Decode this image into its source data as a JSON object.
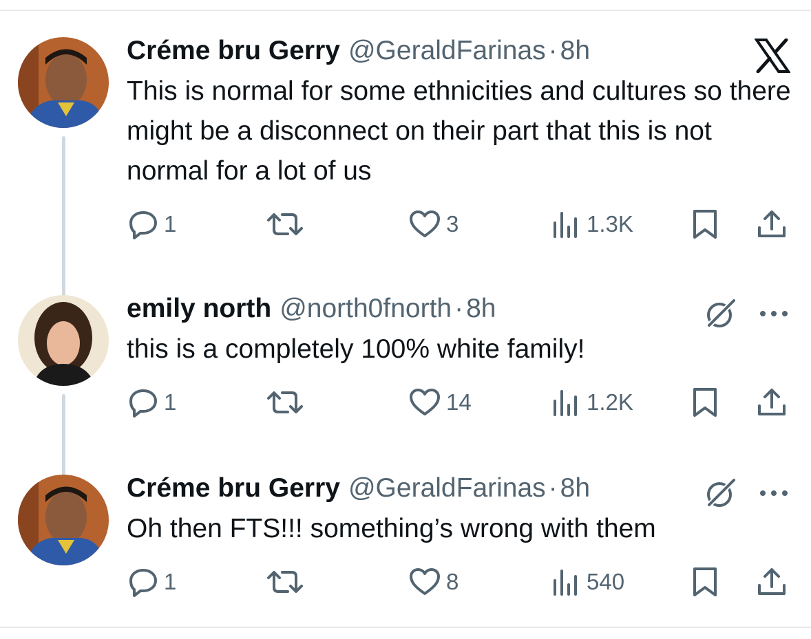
{
  "tweets": [
    {
      "name": "Créme bru Gerry",
      "handle": "@GeraldFarinas",
      "dot": "·",
      "time": "8h",
      "text": "This is normal for some ethnicities and cultures so there might be a disconnect on their part that this is not normal for a lot of us",
      "replies": "1",
      "likes": "3",
      "views": "1.3K",
      "corner_icon": "x-logo-icon"
    },
    {
      "name": "emily north",
      "handle": "@north0fnorth",
      "dot": "·",
      "time": "8h",
      "text": "this is a completely 100% white family!",
      "replies": "1",
      "likes": "14",
      "views": "1.2K",
      "corner_icon": "grok-icon"
    },
    {
      "name": "Créme bru Gerry",
      "handle": "@GeraldFarinas",
      "dot": "·",
      "time": "8h",
      "text": "Oh then FTS!!! something’s wrong with them",
      "replies": "1",
      "likes": "8",
      "views": "540",
      "corner_icon": "grok-icon"
    }
  ],
  "colors": {
    "text_primary": "#0f1419",
    "text_secondary": "#536471",
    "thread_line": "#cfd9de",
    "divider": "#e6e9ec"
  }
}
